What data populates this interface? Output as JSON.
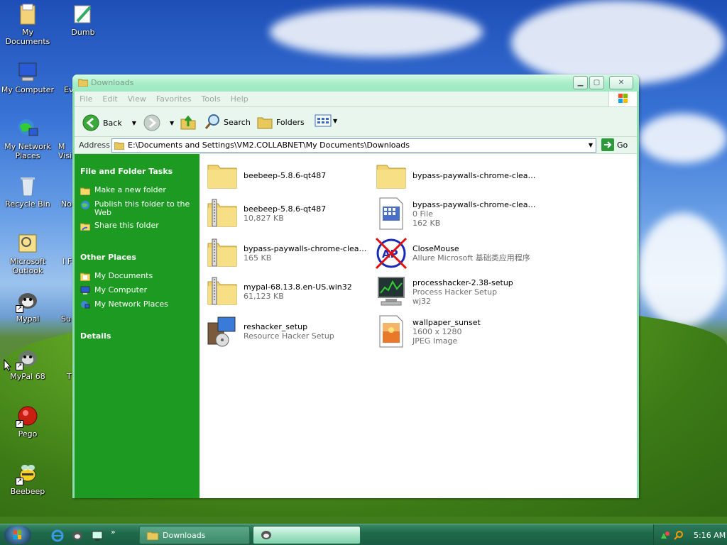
{
  "desktop": {
    "icons": [
      {
        "label": "My Documents",
        "icon": "my-documents-icon"
      },
      {
        "label": "Dumb",
        "icon": "dumb-icon"
      },
      {
        "label": "My Computer",
        "icon": "my-computer-icon"
      },
      {
        "label": "Ev",
        "icon": "everything-icon"
      },
      {
        "label": "My Network Places",
        "icon": "network-places-icon"
      },
      {
        "label": "M Visi",
        "icon": "visio-icon"
      },
      {
        "label": "Recycle Bin",
        "icon": "recycle-bin-icon"
      },
      {
        "label": "No",
        "icon": "notepad-icon"
      },
      {
        "label": "Microsoft Outlook",
        "icon": "outlook-icon"
      },
      {
        "label": "I F",
        "icon": "app-icon"
      },
      {
        "label": "Mypal",
        "icon": "mypal-icon"
      },
      {
        "label": "Su",
        "icon": "app-icon"
      },
      {
        "label": "MyPal 68",
        "icon": "mypal-68-icon"
      },
      {
        "label": "T",
        "icon": "app-icon"
      },
      {
        "label": "Pego",
        "icon": "pego-icon"
      },
      {
        "label": "Beebeep",
        "icon": "beebeep-icon"
      }
    ]
  },
  "window": {
    "title": "Downloads",
    "menu": [
      "File",
      "Edit",
      "View",
      "Favorites",
      "Tools",
      "Help"
    ],
    "toolbar": {
      "back_label": "Back",
      "search_label": "Search",
      "folders_label": "Folders"
    },
    "address": {
      "label": "Address",
      "value": "E:\\Documents and Settings\\VM2.COLLABNET\\My Documents\\Downloads",
      "go_label": "Go"
    }
  },
  "taskpane": {
    "file_folder_tasks": {
      "heading": "File and Folder Tasks",
      "items": [
        "Make a new folder",
        "Publish this folder to the Web",
        "Share this folder"
      ]
    },
    "other_places": {
      "heading": "Other Places",
      "items": [
        "My Documents",
        "My Computer",
        "My Network Places"
      ]
    },
    "details": {
      "heading": "Details"
    }
  },
  "files": [
    {
      "name": "beebeep-5.8.6-qt487",
      "sub1": "",
      "sub2": "",
      "icon": "folder-icon"
    },
    {
      "name": "bypass-paywalls-chrome-clean-v...",
      "sub1": "",
      "sub2": "",
      "icon": "folder-icon"
    },
    {
      "name": "beebeep-5.8.6-qt487",
      "sub1": "10,827 KB",
      "sub2": "",
      "icon": "zip-folder-icon"
    },
    {
      "name": "bypass-paywalls-chrome-clean-3....",
      "sub1": "0 File",
      "sub2": "162 KB",
      "icon": "file-icon"
    },
    {
      "name": "bypass-paywalls-chrome-clean-v...",
      "sub1": "165 KB",
      "sub2": "",
      "icon": "zip-folder-icon"
    },
    {
      "name": "CloseMouse",
      "sub1": "Allure Microsoft 基础类应用程序",
      "sub2": "",
      "icon": "closemouse-icon"
    },
    {
      "name": "mypal-68.13.8.en-US.win32",
      "sub1": "61,123 KB",
      "sub2": "",
      "icon": "zip-folder-icon"
    },
    {
      "name": "processhacker-2.38-setup",
      "sub1": "Process Hacker Setup",
      "sub2": "wj32",
      "icon": "processhacker-icon"
    },
    {
      "name": "reshacker_setup",
      "sub1": "Resource Hacker Setup",
      "sub2": "",
      "icon": "installer-icon"
    },
    {
      "name": "wallpaper_sunset",
      "sub1": "1600 x 1280",
      "sub2": "JPEG Image",
      "icon": "image-icon"
    }
  ],
  "taskbar": {
    "buttons": [
      {
        "label": "Downloads",
        "icon": "folder-icon"
      },
      {
        "label": "",
        "icon": "mypal-icon"
      }
    ],
    "clock": "5:16 AM"
  }
}
